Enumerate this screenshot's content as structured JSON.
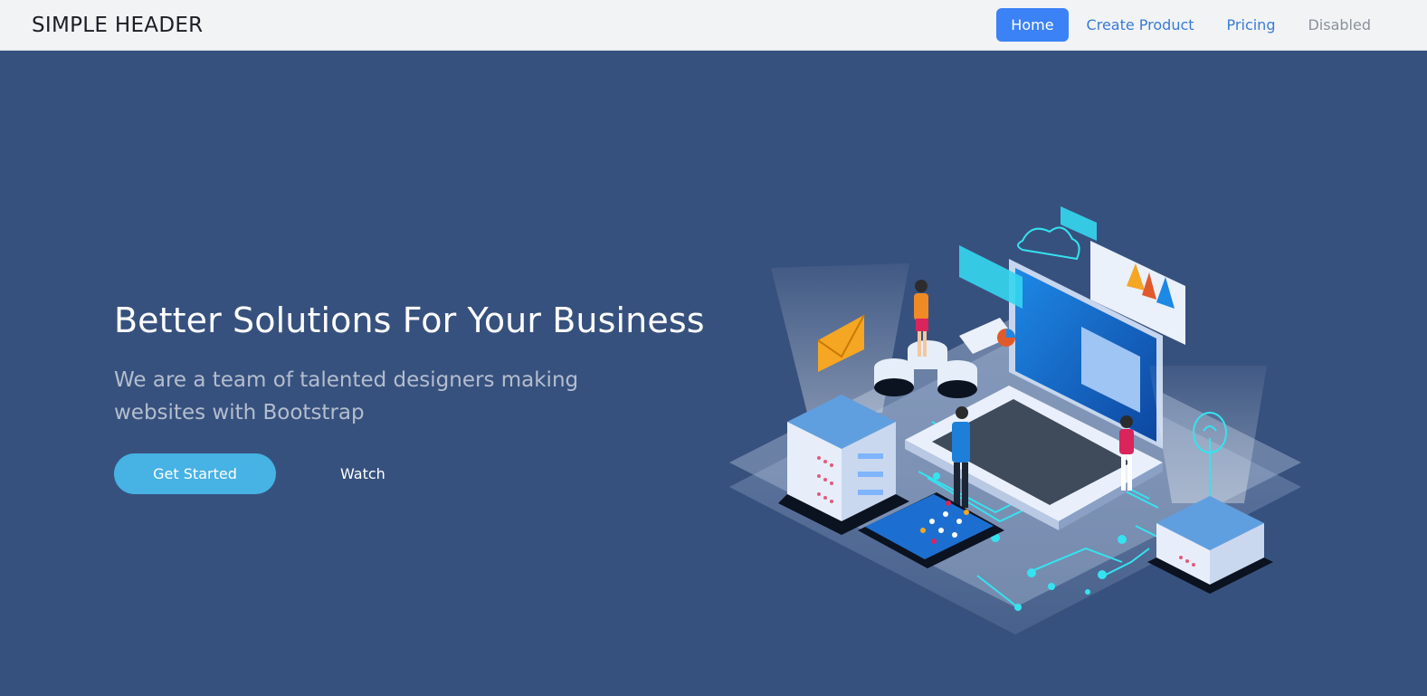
{
  "header": {
    "brand": "SIMPLE HEADER",
    "nav": [
      {
        "label": "Home",
        "state": "active"
      },
      {
        "label": "Create Product",
        "state": "normal"
      },
      {
        "label": "Pricing",
        "state": "normal"
      },
      {
        "label": "Disabled",
        "state": "disabled"
      }
    ]
  },
  "hero": {
    "title": "Better Solutions For Your Business",
    "subtitle": "We are a team of talented designers making websites with Bootstrap",
    "primary_button": "Get Started",
    "secondary_button": "Watch",
    "illustration": "isometric-tech-illustration"
  },
  "colors": {
    "header_bg": "#f1f3f5",
    "hero_bg": "#37517e",
    "accent": "#47b2e4",
    "nav_active": "#3b82f6",
    "nav_link": "#3a7bd5"
  }
}
